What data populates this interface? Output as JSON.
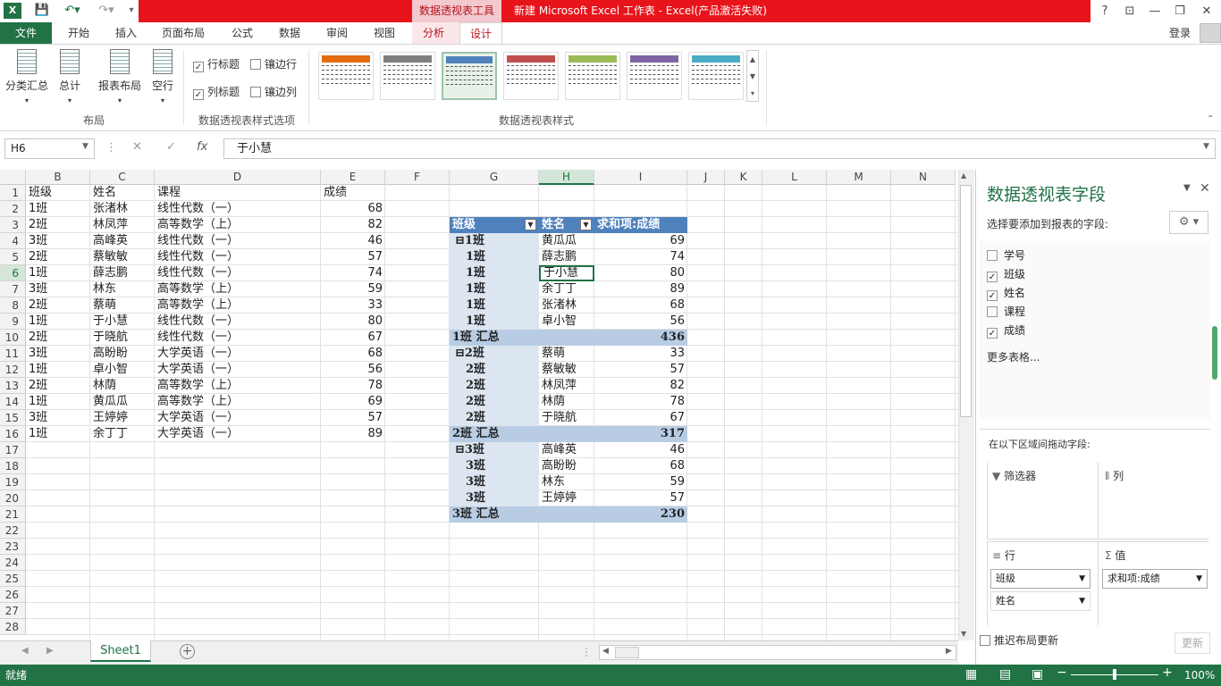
{
  "titlebar": {
    "app_icon": "excel-logo",
    "context_tools": "数据透视表工具",
    "window_title": "新建 Microsoft Excel 工作表 -  Excel(产品激活失败)",
    "help": "?",
    "window_controls": [
      "restore-ribbon-icon",
      "minimize-icon",
      "maximize-icon",
      "close-icon"
    ]
  },
  "tabs": {
    "file": "文件",
    "home": "开始",
    "insert": "插入",
    "layout": "页面布局",
    "formulas": "公式",
    "data": "数据",
    "review": "审阅",
    "view": "视图",
    "analyze": "分析",
    "design": "设计",
    "login": "登录"
  },
  "ribbon": {
    "layout_group": {
      "label": "布局",
      "subtotals": "分类汇总",
      "grand_totals": "总计",
      "report_layout": "报表布局",
      "blank_rows": "空行"
    },
    "options_group": {
      "label": "数据透视表样式选项",
      "row_headers": "行标题",
      "banded_rows": "镶边行",
      "col_headers": "列标题",
      "banded_cols": "镶边列"
    },
    "styles_group": {
      "label": "数据透视表样式"
    },
    "style_colors": [
      "#e46c0a",
      "#7f7f7f",
      "#4f81bd",
      "#c0504d",
      "#9bbb59",
      "#8064a2",
      "#4bacc6"
    ]
  },
  "formula_bar": {
    "name_box": "H6",
    "fx": "fx",
    "value": "于小慧"
  },
  "columns": [
    "B",
    "C",
    "D",
    "E",
    "F",
    "G",
    "H",
    "I",
    "J",
    "K",
    "L",
    "M",
    "N"
  ],
  "rows": [
    "1",
    "2",
    "3",
    "4",
    "5",
    "6",
    "7",
    "8",
    "9",
    "10",
    "11",
    "12",
    "13",
    "14",
    "15",
    "16",
    "17",
    "18",
    "19",
    "20",
    "21",
    "22",
    "23",
    "24",
    "25",
    "26",
    "27",
    "28"
  ],
  "source_table": {
    "headers": [
      "班级",
      "姓名",
      "课程",
      "成绩"
    ],
    "rows": [
      [
        "1班",
        "张渚林",
        "线性代数（一）",
        "68"
      ],
      [
        "2班",
        "林凤萍",
        "高等数学（上）",
        "82"
      ],
      [
        "3班",
        "高峰英",
        "线性代数（一）",
        "46"
      ],
      [
        "2班",
        "蔡敏敏",
        "线性代数（一）",
        "57"
      ],
      [
        "1班",
        "薛志鹏",
        "线性代数（一）",
        "74"
      ],
      [
        "3班",
        "林东",
        "高等数学（上）",
        "59"
      ],
      [
        "2班",
        "蔡萌",
        "高等数学（上）",
        "33"
      ],
      [
        "1班",
        "于小慧",
        "线性代数（一）",
        "80"
      ],
      [
        "2班",
        "于晓航",
        "线性代数（一）",
        "67"
      ],
      [
        "3班",
        "高盼盼",
        "大学英语（一）",
        "68"
      ],
      [
        "1班",
        "卓小智",
        "大学英语（一）",
        "56"
      ],
      [
        "2班",
        "林荫",
        "高等数学（上）",
        "78"
      ],
      [
        "1班",
        "黄瓜瓜",
        "高等数学（上）",
        "69"
      ],
      [
        "3班",
        "王婷婷",
        "大学英语（一）",
        "57"
      ],
      [
        "1班",
        "余丁丁",
        "大学英语（一）",
        "89"
      ]
    ]
  },
  "pivot": {
    "headers": [
      "班级",
      "姓名",
      "求和项:成绩"
    ],
    "rows": [
      {
        "type": "group",
        "class": "⊟1班",
        "name": "黄瓜瓜",
        "value": "69"
      },
      {
        "type": "item",
        "class": "1班",
        "name": "薛志鹏",
        "value": "74"
      },
      {
        "type": "item",
        "class": "1班",
        "name": "于小慧",
        "value": "80"
      },
      {
        "type": "item",
        "class": "1班",
        "name": "余丁丁",
        "value": "89"
      },
      {
        "type": "item",
        "class": "1班",
        "name": "张渚林",
        "value": "68"
      },
      {
        "type": "item",
        "class": "1班",
        "name": "卓小智",
        "value": "56"
      },
      {
        "type": "subtotal",
        "class": "1班 汇总",
        "name": "",
        "value": "436"
      },
      {
        "type": "group",
        "class": "⊟2班",
        "name": "蔡萌",
        "value": "33"
      },
      {
        "type": "item",
        "class": "2班",
        "name": "蔡敏敏",
        "value": "57"
      },
      {
        "type": "item",
        "class": "2班",
        "name": "林凤萍",
        "value": "82"
      },
      {
        "type": "item",
        "class": "2班",
        "name": "林荫",
        "value": "78"
      },
      {
        "type": "item",
        "class": "2班",
        "name": "于晓航",
        "value": "67"
      },
      {
        "type": "subtotal",
        "class": "2班 汇总",
        "name": "",
        "value": "317"
      },
      {
        "type": "group",
        "class": "⊟3班",
        "name": "高峰英",
        "value": "46"
      },
      {
        "type": "item",
        "class": "3班",
        "name": "高盼盼",
        "value": "68"
      },
      {
        "type": "item",
        "class": "3班",
        "name": "林东",
        "value": "59"
      },
      {
        "type": "item",
        "class": "3班",
        "name": "王婷婷",
        "value": "57"
      },
      {
        "type": "subtotal",
        "class": "3班 汇总",
        "name": "",
        "value": "230"
      }
    ]
  },
  "sheet_tabs": {
    "sheet1": "Sheet1",
    "add": "+"
  },
  "status": {
    "ready": "就绪",
    "zoom": "100%"
  },
  "pane": {
    "title": "数据透视表字段",
    "choose_label": "选择要添加到报表的字段:",
    "fields": [
      {
        "label": "学号",
        "checked": false
      },
      {
        "label": "班级",
        "checked": true
      },
      {
        "label": "姓名",
        "checked": true
      },
      {
        "label": "课程",
        "checked": false
      },
      {
        "label": "成绩",
        "checked": true
      }
    ],
    "more_tables": "更多表格...",
    "drag_label": "在以下区域间拖动字段:",
    "filters": "筛选器",
    "columns": "列",
    "rows": "行",
    "values": "值",
    "row_fields": [
      "班级",
      "姓名"
    ],
    "value_fields": [
      "求和项:成绩"
    ],
    "defer": "推迟布局更新",
    "update": "更新"
  }
}
